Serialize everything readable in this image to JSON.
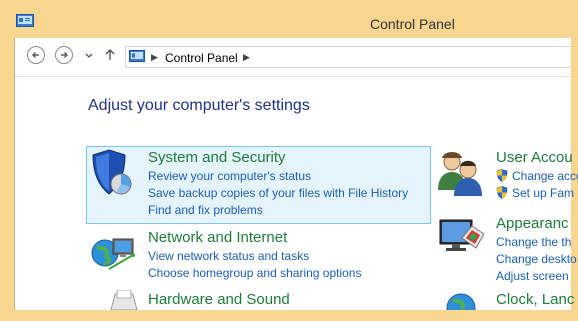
{
  "window": {
    "title": "Control Panel"
  },
  "address": {
    "crumb": "Control Panel"
  },
  "heading": "Adjust your computer's settings",
  "categories": {
    "system": {
      "title": "System and Security",
      "links": [
        "Review your computer's status",
        "Save backup copies of your files with File History",
        "Find and fix problems"
      ]
    },
    "network": {
      "title": "Network and Internet",
      "links": [
        "View network status and tasks",
        "Choose homegroup and sharing options"
      ]
    },
    "hardware": {
      "title": "Hardware and Sound"
    },
    "users": {
      "title": "User Accou",
      "links": [
        "Change acco",
        "Set up Fam"
      ]
    },
    "appearance": {
      "title": "Appearanc",
      "links": [
        "Change the th",
        "Change deskto",
        "Adjust screen"
      ]
    },
    "clock": {
      "title": "Clock, Lanc"
    }
  },
  "colors": {
    "frame": "#f6d690",
    "link": "#1a5fb4",
    "category": "#1e7b3a",
    "heading": "#1e3287"
  }
}
